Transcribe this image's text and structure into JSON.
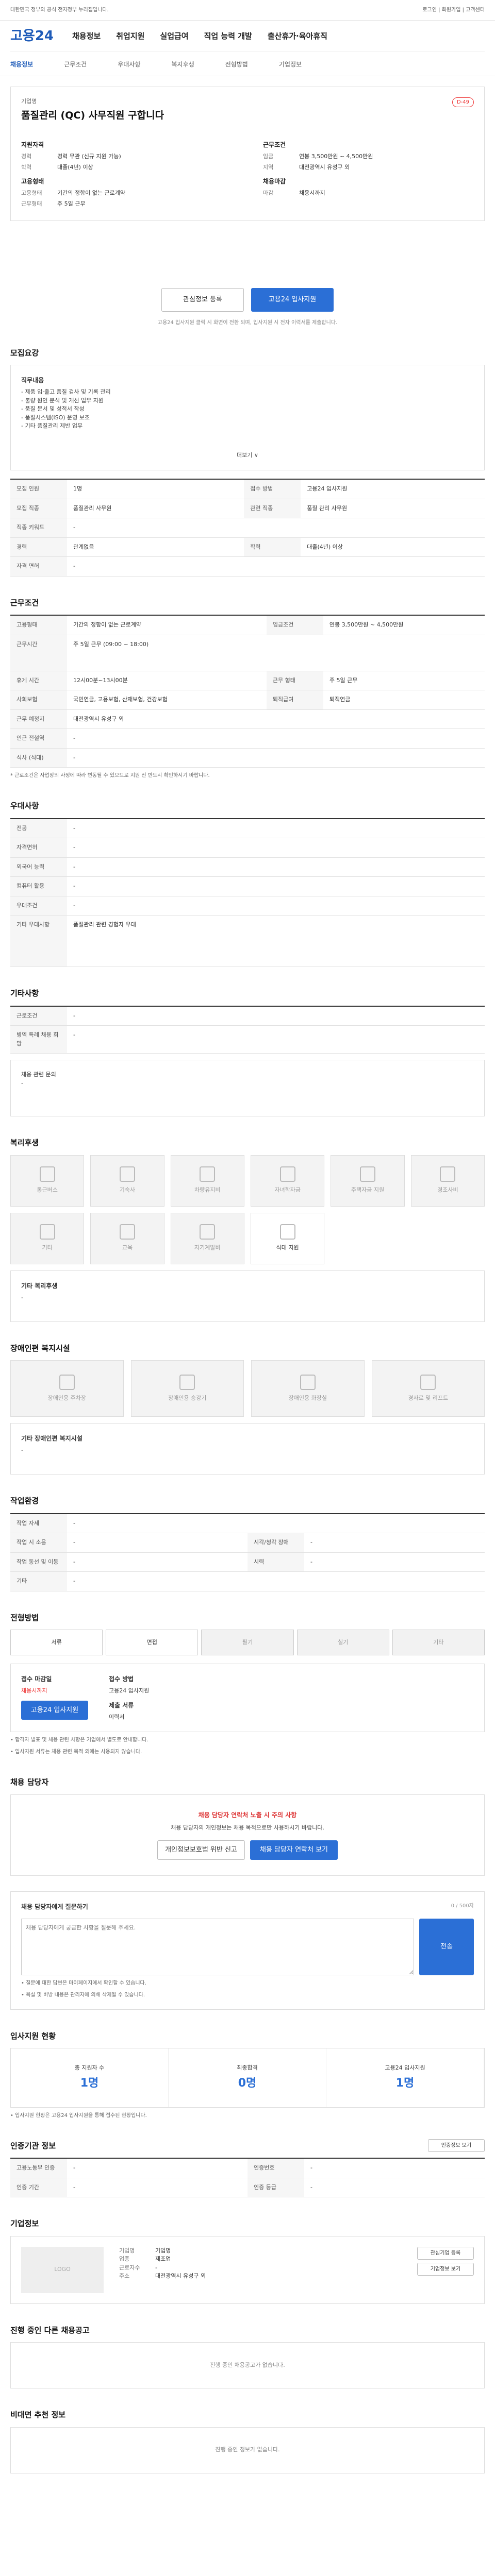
{
  "topbar": {
    "notice": "대한민국 정부의 공식 전자정부 누리집입니다.",
    "right": "로그인 | 회원가입 | 고객센터"
  },
  "header": {
    "logo": "고용24",
    "menu": [
      "채용정보",
      "취업지원",
      "실업급여",
      "직업 능력 개발",
      "출산휴가·육아휴직"
    ]
  },
  "subnav": [
    "채용정보",
    "근무조건",
    "우대사항",
    "복지후생",
    "전형방법",
    "기업정보"
  ],
  "job": {
    "company": "기업명",
    "title": "품질관리 (QC) 사무직원 구합니다",
    "dday": "D-49",
    "left_head": "지원자격",
    "left": [
      [
        "경력",
        "경력 무관 (신규 지원 가능)"
      ],
      [
        "학력",
        "대졸(4년) 이상"
      ]
    ],
    "left2_head": "고용형태",
    "left2": [
      [
        "고용형태",
        "기간의 정함이 없는 근로계약"
      ],
      [
        "근무형태",
        "주 5일 근무"
      ]
    ],
    "right_head": "근무조건",
    "right": [
      [
        "임금",
        "연봉 3,500만원 ~ 4,500만원"
      ],
      [
        "지역",
        "대전광역시 유성구 외 "
      ]
    ],
    "right2_head": "채용마감",
    "right2": [
      [
        "마감",
        "채용시까지"
      ]
    ],
    "btn_favorite": "관심정보 등록",
    "btn_apply": "고용24 입사지원",
    "notice": "고용24 입사지원 클릭 시 화면이 전환 되며, 입사지원 시 전자 이력서를 제출합니다."
  },
  "recruit": {
    "section_title": "모집요강",
    "desc_title": "직무내용",
    "desc": [
      "- 제품 입·출고 품질 검사 및 기록 관리",
      "- 불량 원인 분석 및 개선 업무 지원",
      "- 품질 문서 및 성적서 작성",
      "- 품질시스템(ISO) 운영 보조",
      "- 기타 품질관리 제반 업무"
    ],
    "more": "더보기 ∨",
    "table": [
      [
        "모집 인원",
        "1명",
        "접수 방법",
        "고용24 입사지원"
      ],
      [
        "모집 직종",
        "품질관리 사무원",
        "관련 직종",
        "품질 관리 사무원"
      ],
      [
        "직종 키워드",
        "-",
        "",
        ""
      ],
      [
        "경력",
        "관계없음",
        "학력",
        "대졸(4년) 이상"
      ],
      [
        "자격 면허",
        "-",
        "",
        ""
      ]
    ]
  },
  "conditions": {
    "section_title": "근무조건",
    "table": [
      [
        "고용형태",
        "기간의 정함이 없는 근로계약",
        "임금조건",
        "연봉 3,500만원 ~ 4,500만원"
      ],
      [
        "근무시간",
        "주 5일 근무 (09:00 ~ 18:00)",
        "",
        ""
      ],
      [
        "휴게 시간",
        "12시00분~13시00분",
        "근무 형태",
        "주 5일 근무"
      ],
      [
        "사회보험",
        "국민연금, 고용보험, 산재보험, 건강보험",
        "퇴직급여",
        "퇴직연금"
      ],
      [
        "근무 예정지",
        "대전광역시 유성구 외 ",
        "",
        ""
      ],
      [
        "인근 전철역",
        "-",
        "",
        ""
      ],
      [
        "식사 (식대)",
        "-",
        "",
        ""
      ]
    ],
    "note": "* 근로조건은 사업장의 사정에 따라 변동될 수 있으므로 지원 전 반드시 확인하시기 바랍니다."
  },
  "preference": {
    "section_title": "우대사항",
    "table": [
      [
        "전공",
        "-"
      ],
      [
        "자격면허",
        "-"
      ],
      [
        "외국어 능력",
        "-"
      ],
      [
        "컴퓨터 활용",
        "-"
      ],
      [
        "우대조건",
        "-"
      ],
      [
        "기타 우대사항",
        "품질관리 관련 경험자 우대"
      ]
    ]
  },
  "other": {
    "section_title": "기타사항",
    "table": [
      [
        "근로조건",
        "-"
      ],
      [
        "병역 특례 채용 희망",
        "-"
      ],
      [
        "채용 관련 문의",
        "-"
      ]
    ]
  },
  "welfare": {
    "section_title": "복리후생",
    "items": [
      "통근버스",
      "기숙사",
      "차량유지비",
      "자녀학자금",
      "주택자금 지원",
      "경조사비",
      "기타",
      "교육",
      "자기계발비",
      "식대 지원"
    ],
    "active_index": 9,
    "other_title": "기타 복리후생",
    "other_value": "-"
  },
  "disabled": {
    "section_title": "장애인편 복지시설",
    "items": [
      "장애인용 주차장",
      "장애인용 승강기",
      "장애인용 화장실",
      "경사로 및 리프트"
    ],
    "other_title": "기타 장애인편 복지시설",
    "other_value": "-"
  },
  "environment": {
    "section_title": "작업환경",
    "table": [
      [
        "작업 자세",
        "-",
        "",
        ""
      ],
      [
        "작업 시 소음",
        "-",
        "시각/청각 장애",
        "-"
      ],
      [
        "작업 동선 및 이동",
        "-",
        "시력",
        "-"
      ],
      [
        "기타",
        "-",
        "",
        ""
      ]
    ]
  },
  "process": {
    "section_title": "전형방법",
    "steps": [
      "서류",
      "면접",
      "필기",
      "실기",
      "기타"
    ],
    "active": [
      true,
      true,
      false,
      false,
      false
    ],
    "apply_head": "접수 마감일",
    "deadline": "채용시까지",
    "method_head": "접수 방법",
    "method": "고용24 입사지원",
    "docs_head": "제출 서류",
    "docs": "이력서",
    "apply_btn": "고용24 입사지원",
    "notes": [
      "• 합격자 발표 및 채용 관련 사항은 기업에서 별도로 안내합니다.",
      "• 입사지원 서류는 채용 관련 목적 외에는 사용되지 않습니다."
    ]
  },
  "manager": {
    "section_title": "채용 담당자",
    "warn": "채용 담당자 연락처 노출 시 주의 사항",
    "text": "채용 담당자의 개인정보는 채용 목적으로만 사용하시기 바랍니다.",
    "btn1": "개인정보보호법 위반 신고",
    "btn2": "채용 담당자 연락처 보기"
  },
  "qa": {
    "section_title": "채용 담당자에게 질문하기",
    "placeholder": "채용 담당자에게 궁금한 사항을 질문해 주세요.",
    "counter": "0 / 500자",
    "submit": "전송",
    "notes": [
      "• 질문에 대한 답변은 마이페이지에서 확인할 수 있습니다.",
      "• 욕설 및 비방 내용은 관리자에 의해 삭제될 수 있습니다."
    ]
  },
  "stats": {
    "section_title": "입사지원 현황",
    "items": [
      [
        "총 지원자 수",
        "1명"
      ],
      [
        "최종합격",
        "0명"
      ],
      [
        "고용24 입사지원",
        "1명"
      ]
    ],
    "note": "• 입사지원 현황은 고용24 입사지원을 통해 접수된 현황입니다."
  },
  "cert": {
    "section_title": "인증기관 정보",
    "btn": "인증정보 보기",
    "table": [
      [
        "고용노동부 인증",
        "-",
        "인증번호",
        "-"
      ],
      [
        "인증 기간",
        "-",
        "인증 등급",
        "-"
      ]
    ]
  },
  "company": {
    "section_title": "기업정보",
    "logo_ph": "LOGO",
    "kv": [
      [
        "기업명",
        "기업명"
      ],
      [
        "업종",
        "제조업"
      ],
      [
        "근로자수",
        "-"
      ],
      [
        "주소",
        "대전광역시 유성구 외 "
      ]
    ],
    "btn1": "관심기업 등록",
    "btn2": "기업정보 보기"
  },
  "related": {
    "section_title": "진행 중인 다른 채용공고",
    "empty": "진행 중인 채용공고가 없습니다."
  },
  "video": {
    "section_title": "비대면 추천 정보",
    "empty": "진행 중인 정보가 없습니다."
  }
}
